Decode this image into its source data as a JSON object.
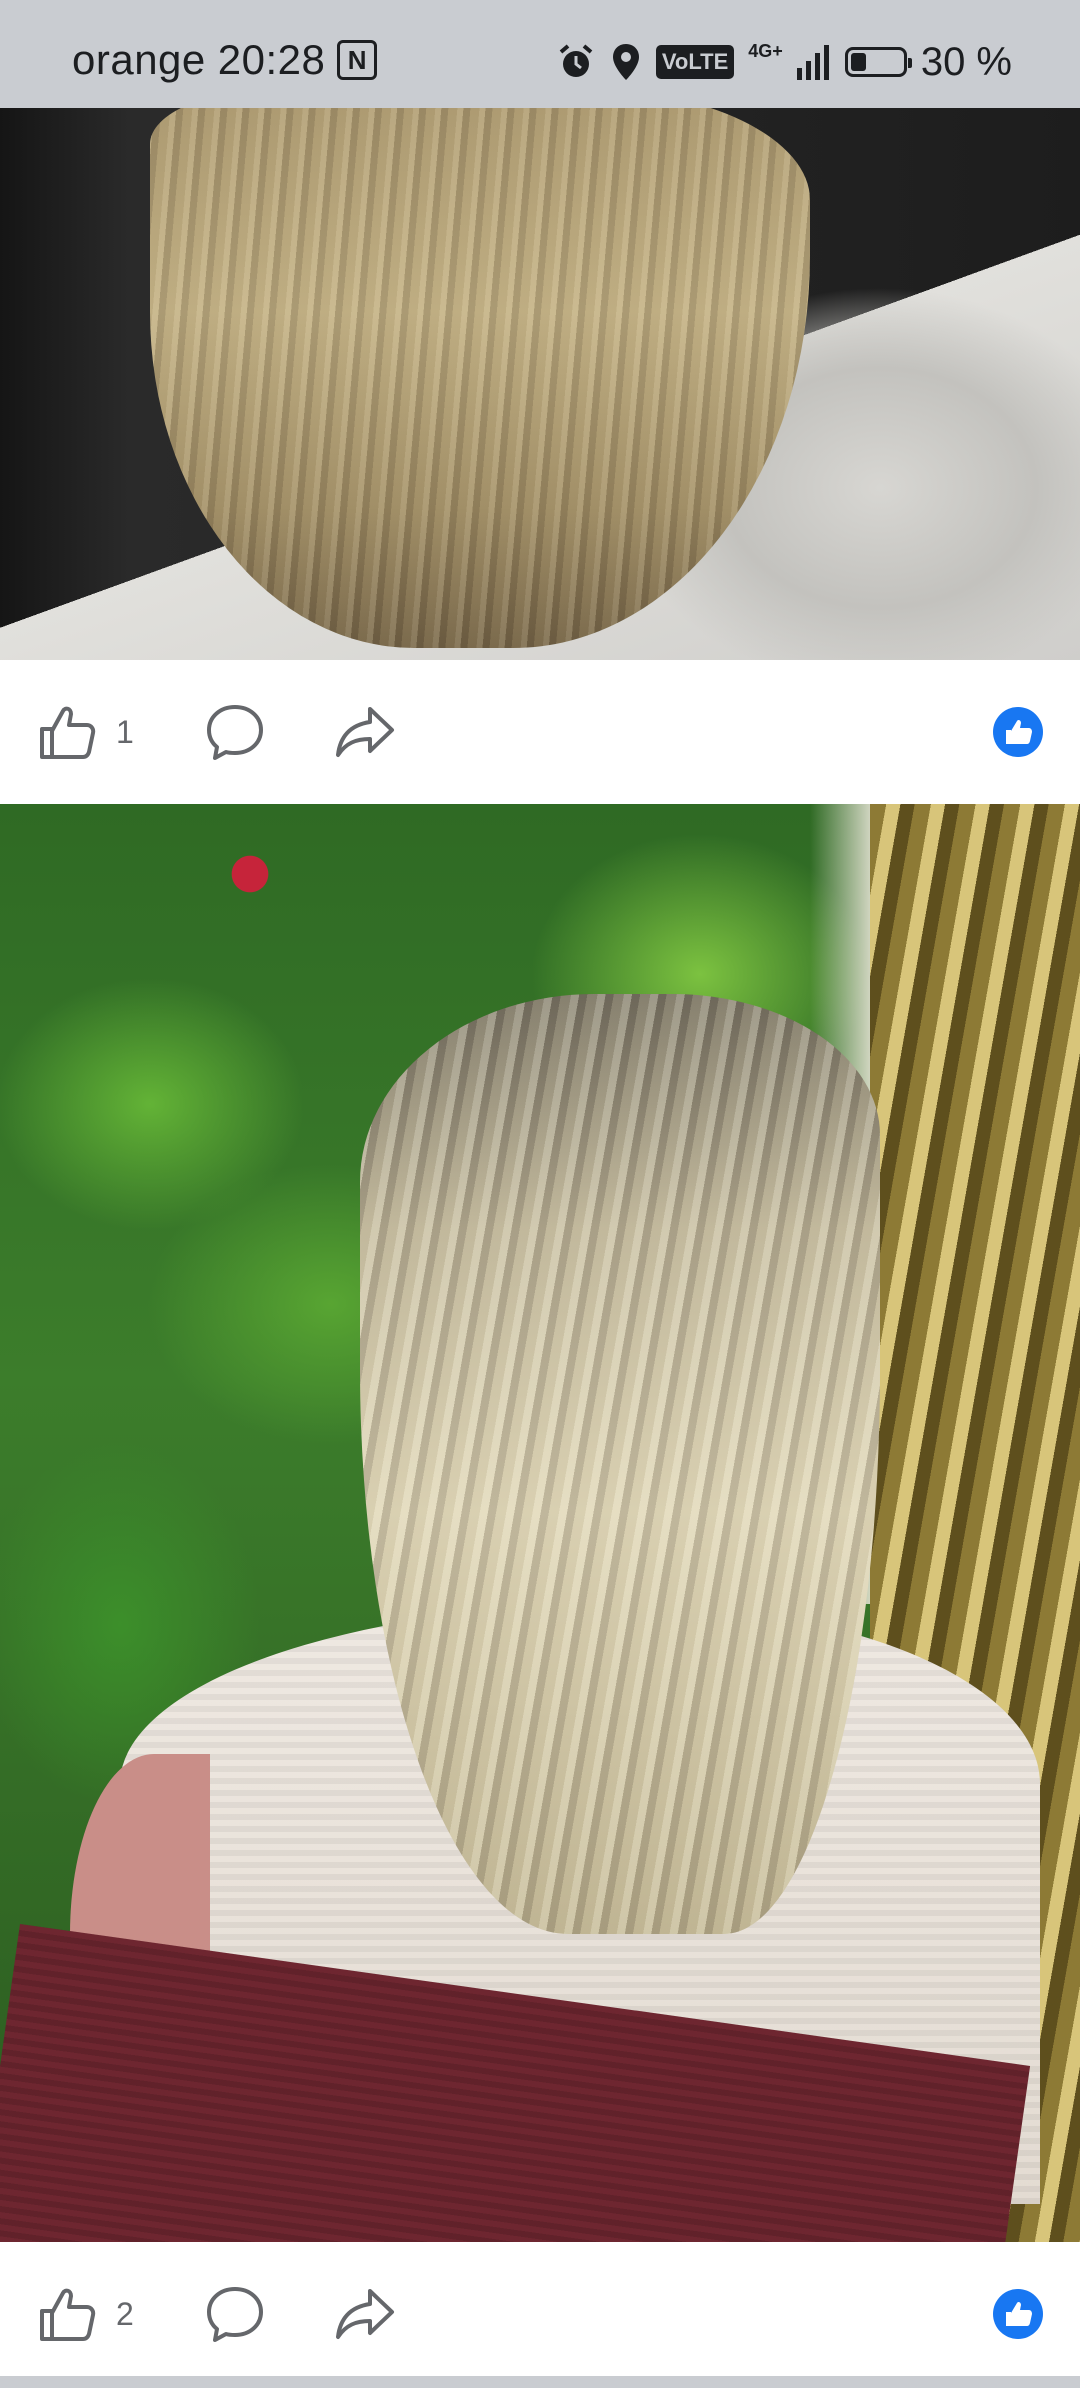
{
  "status_bar": {
    "carrier": "orange",
    "time": "20:28",
    "nfc_label": "N",
    "volte_label": "VoLTE",
    "network_label": "4G+",
    "battery_percent": "30 %",
    "battery_level": 0.3
  },
  "posts": [
    {
      "image_description_icon": "hair-before-photo",
      "like_count": "1"
    },
    {
      "image_description_icon": "hair-after-photo",
      "like_count": "2"
    }
  ],
  "icons": {
    "like": "thumbs-up-icon",
    "comment": "comment-bubble-icon",
    "share": "share-arrow-icon",
    "reaction": "facebook-like-reaction-icon"
  },
  "colors": {
    "background": "#c9ccd1",
    "action_bar": "#ffffff",
    "icon": "#65676b",
    "fb_blue": "#1877f2"
  }
}
